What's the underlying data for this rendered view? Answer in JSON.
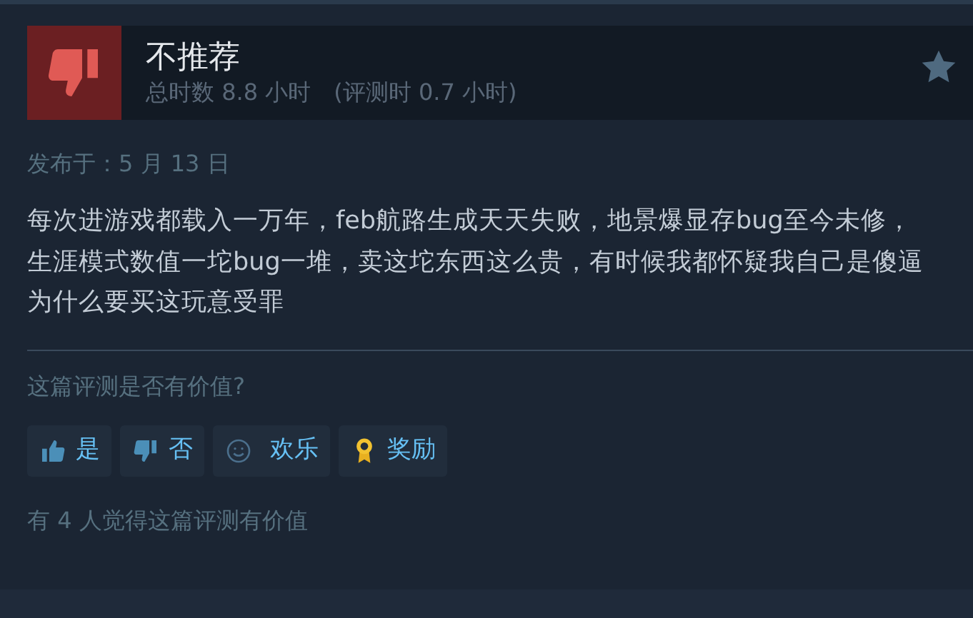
{
  "review": {
    "recommended": false,
    "verdict": "不推荐",
    "hours": "总时数 8.8 小时",
    "review_hours": "(评测时 0.7 小时)",
    "posted": "发布于：5 月 13 日",
    "body": "每次进游戏都载入一万年，feb航路生成天天失败，地景爆显存bug至今未修，生涯模式数值一坨bug一堆，卖这坨东西这么贵，有时候我都怀疑我自己是傻逼为什么要买这玩意受罪"
  },
  "helpful_prompt": "这篇评测是否有价值?",
  "buttons": [
    {
      "kind": "yes",
      "label": "是"
    },
    {
      "kind": "no",
      "label": "否"
    },
    {
      "kind": "funny",
      "label": "欢乐"
    },
    {
      "kind": "award",
      "label": "奖励"
    }
  ],
  "helpful_count": "有 4 人觉得这篇评测有价值"
}
